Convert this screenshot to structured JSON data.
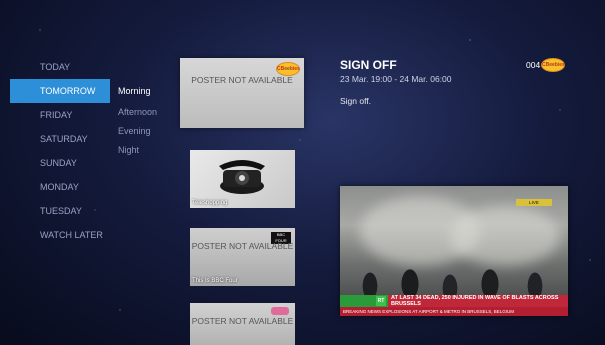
{
  "days": [
    "TODAY",
    "TOMORROW",
    "FRIDAY",
    "SATURDAY",
    "SUNDAY",
    "MONDAY",
    "TUESDAY",
    "WATCH LATER"
  ],
  "times": [
    "Morning",
    "Afternoon",
    "Evening",
    "Night"
  ],
  "posters": {
    "big_text": "POSTER NOT AVAILABLE",
    "big_logo": "CBeebies",
    "tele_label": "Teleshopping",
    "bbc4_text": "POSTER NOT AVAILABLE",
    "bbc4_label": "This Is BBC Four",
    "bbc4_logo": "BBC FOUR",
    "last_text": "POSTER NOT AVAILABLE"
  },
  "detail": {
    "title": "SIGN OFF",
    "time": "23 Mar. 19:00 - 24 Mar. 06:00",
    "description": "Sign off.",
    "channel_number": "004",
    "channel_logo": "CBeebies"
  },
  "video": {
    "headline": "AT LAST 34 DEAD, 250 INJURED IN WAVE OF BLASTS ACROSS BRUSSELS",
    "ticker": "BREAKING NEWS   EXPLOSIONS AT AIRPORT & METRO IN BRUSSELS, BELGIUM",
    "channel_badge": "RT",
    "live_badge": "LIVE"
  },
  "colors": {
    "highlight": "#2c8fd8",
    "background": "#141b3d"
  }
}
